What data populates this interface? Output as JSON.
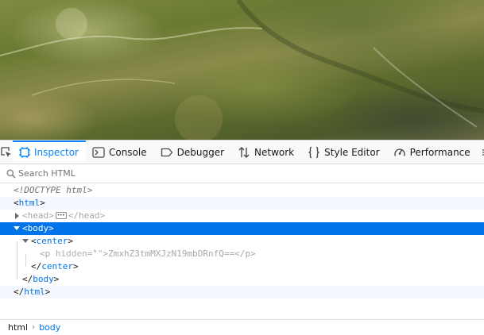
{
  "toolbox": {
    "tabs": [
      {
        "label": "Inspector",
        "icon": "inspector-icon"
      },
      {
        "label": "Console",
        "icon": "console-icon"
      },
      {
        "label": "Debugger",
        "icon": "debugger-icon"
      },
      {
        "label": "Network",
        "icon": "network-icon"
      },
      {
        "label": "Style Editor",
        "icon": "style-editor-icon"
      },
      {
        "label": "Performance",
        "icon": "performance-icon"
      }
    ],
    "selected_tab": "Inspector",
    "accent_color": "#0a84ff"
  },
  "search": {
    "placeholder": "Search HTML"
  },
  "markup": {
    "doctype": "<!DOCTYPE html>",
    "html_tag": "html",
    "head_tag": "head",
    "body_tag": "body",
    "center_tag": "center",
    "p_tag": "p",
    "p_attr_name": "hidden",
    "p_attr_value": "\"\"",
    "p_text": "ZmxhZ3tmMXJzN19mbDRnfQ=="
  },
  "breadcrumbs": [
    {
      "label": "html"
    },
    {
      "label": "body"
    }
  ],
  "colors": {
    "selection": "#0074e8",
    "tag": "#0074e8"
  }
}
